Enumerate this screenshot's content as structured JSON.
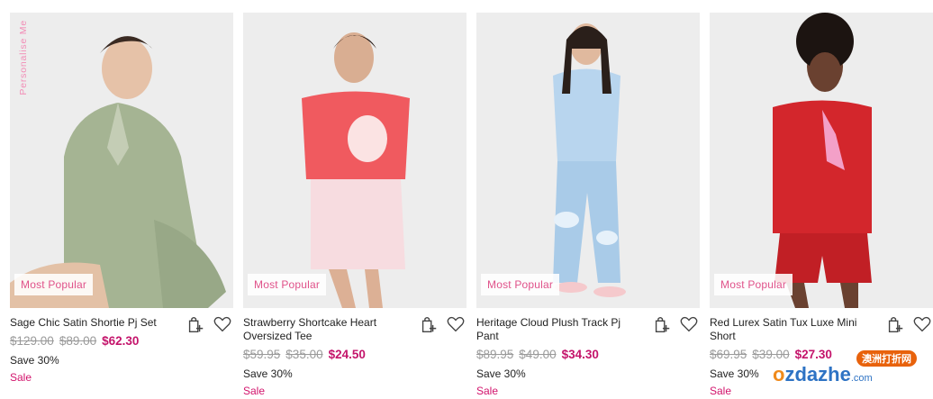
{
  "products": [
    {
      "title": "Sage Chic Satin Shortie Pj Set",
      "badge": "Most Popular",
      "overlay": "Personalise Me",
      "was_price_1": "$129.00",
      "was_price_2": "$89.00",
      "price": "$62.30",
      "save": "Save 30%",
      "sale": "Sale",
      "garment_color": "#a5b493",
      "background_color": "#ececec"
    },
    {
      "title": "Strawberry Shortcake Heart Oversized Tee",
      "badge": "Most Popular",
      "was_price_1": "$59.95",
      "was_price_2": "$35.00",
      "price": "$24.50",
      "save": "Save 30%",
      "sale": "Sale",
      "garment_color": "#f05a5f",
      "background_color": "#ececec"
    },
    {
      "title": "Heritage Cloud Plush Track Pj Pant",
      "badge": "Most Popular",
      "was_price_1": "$89.95",
      "was_price_2": "$49.00",
      "price": "$34.30",
      "save": "Save 30%",
      "sale": "Sale",
      "garment_color": "#a9cbe8",
      "background_color": "#ececec"
    },
    {
      "title": "Red Lurex Satin Tux Luxe Mini Short",
      "badge": "Most Popular",
      "was_price_1": "$69.95",
      "was_price_2": "$39.00",
      "price": "$27.30",
      "save": "Save 30%",
      "sale": "Sale",
      "garment_color": "#d3262c",
      "background_color": "#ececec"
    }
  ],
  "icons": {
    "add_to_bag": "bag-plus-icon",
    "wishlist": "heart-icon"
  },
  "watermark": {
    "tag": "澳洲打折网",
    "logo_prefix": "o",
    "logo_main": "zdazhe",
    "logo_suffix": ".com"
  },
  "colors": {
    "accent_pink": "#e0528a",
    "sale_price": "#c4146b",
    "strike_price": "#9a9a9a"
  }
}
